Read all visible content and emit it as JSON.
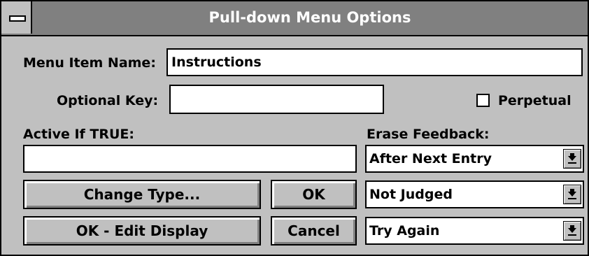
{
  "window": {
    "title": "Pull-down Menu Options"
  },
  "form": {
    "menu_item_name_label": "Menu Item Name:",
    "menu_item_name_value": "Instructions",
    "optional_key_label": "Optional Key:",
    "optional_key_value": "",
    "perpetual_label": "Perpetual",
    "perpetual_checked": false,
    "active_if_label": "Active If TRUE:",
    "active_if_value": "",
    "erase_feedback_label": "Erase Feedback:"
  },
  "dropdowns": {
    "erase_feedback": "After Next Entry",
    "judgement": "Not Judged",
    "try_again": "Try Again"
  },
  "buttons": {
    "change_type": "Change Type...",
    "ok": "OK",
    "ok_edit_display": "OK - Edit Display",
    "cancel": "Cancel"
  },
  "icons": {
    "system_menu": "minus-bar-icon",
    "dropdown_arrow": "down-arrow-underline-icon"
  }
}
